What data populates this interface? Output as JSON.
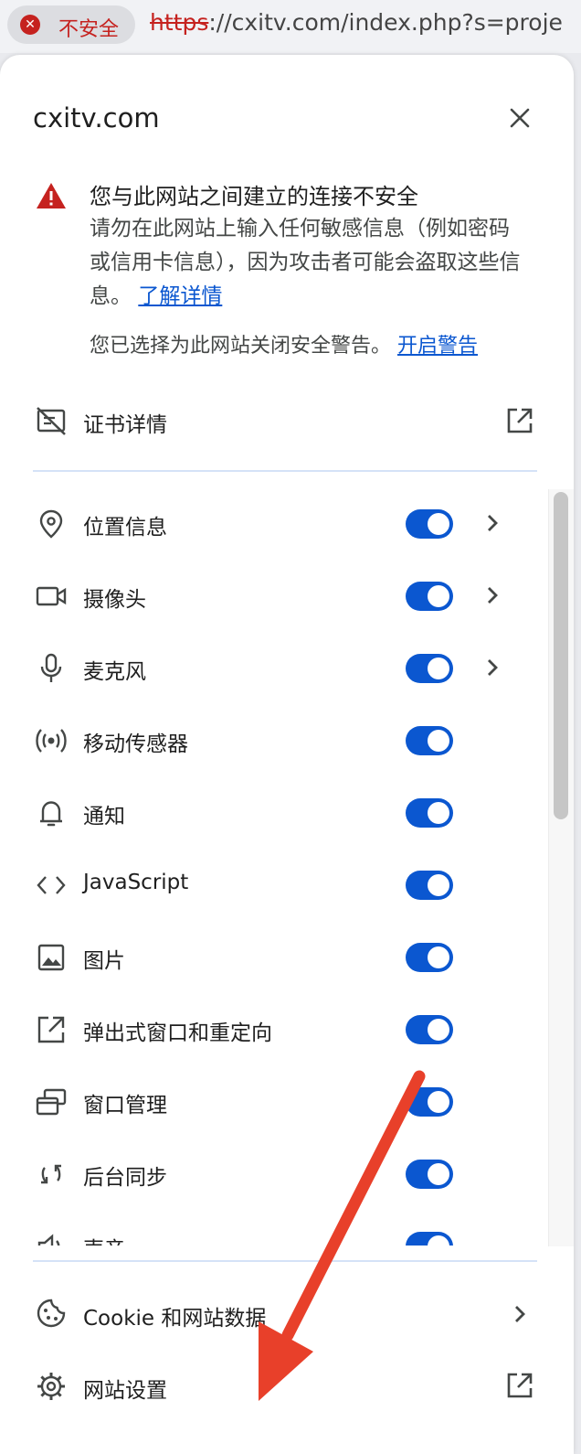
{
  "address_bar": {
    "security_label": "不安全",
    "url_scheme": "https",
    "url_rest": "://cxitv.com/index.php?s=proje"
  },
  "popup": {
    "site": "cxitv.com",
    "warning": {
      "title": "您与此网站之间建立的连接不安全",
      "body": "请勿在此网站上输入任何敏感信息（例如密码或信用卡信息），因为攻击者可能会盗取这些信息。",
      "learn_more": "了解详情",
      "disabled_note": "您已选择为此网站关闭安全警告。",
      "enable_link": "开启警告"
    },
    "certificate": {
      "label": "证书详情",
      "icon": "certificate-off-icon"
    },
    "permissions": [
      {
        "label": "位置信息",
        "icon": "location-pin-icon",
        "enabled": true,
        "has_chevron": true
      },
      {
        "label": "摄像头",
        "icon": "camera-icon",
        "enabled": true,
        "has_chevron": true
      },
      {
        "label": "麦克风",
        "icon": "microphone-icon",
        "enabled": true,
        "has_chevron": true
      },
      {
        "label": "移动传感器",
        "icon": "sensors-icon",
        "enabled": true,
        "has_chevron": false
      },
      {
        "label": "通知",
        "icon": "bell-icon",
        "enabled": true,
        "has_chevron": false
      },
      {
        "label": "JavaScript",
        "icon": "code-icon",
        "enabled": true,
        "has_chevron": false
      },
      {
        "label": "图片",
        "icon": "image-icon",
        "enabled": true,
        "has_chevron": false
      },
      {
        "label": "弹出式窗口和重定向",
        "icon": "open-in-new-icon",
        "enabled": true,
        "has_chevron": false
      },
      {
        "label": "窗口管理",
        "icon": "window-management-icon",
        "enabled": true,
        "has_chevron": false
      },
      {
        "label": "后台同步",
        "icon": "sync-icon",
        "enabled": true,
        "has_chevron": false
      },
      {
        "label": "声音",
        "icon": "volume-icon",
        "enabled": true,
        "has_chevron": false
      }
    ],
    "cookies": {
      "label": "Cookie 和网站数据",
      "icon": "cookie-icon"
    },
    "site_settings": {
      "label": "网站设置",
      "icon": "gear-icon"
    }
  },
  "colors": {
    "accent": "#0b57d0",
    "danger": "#c5221f",
    "annotation_arrow": "#e8402a"
  }
}
